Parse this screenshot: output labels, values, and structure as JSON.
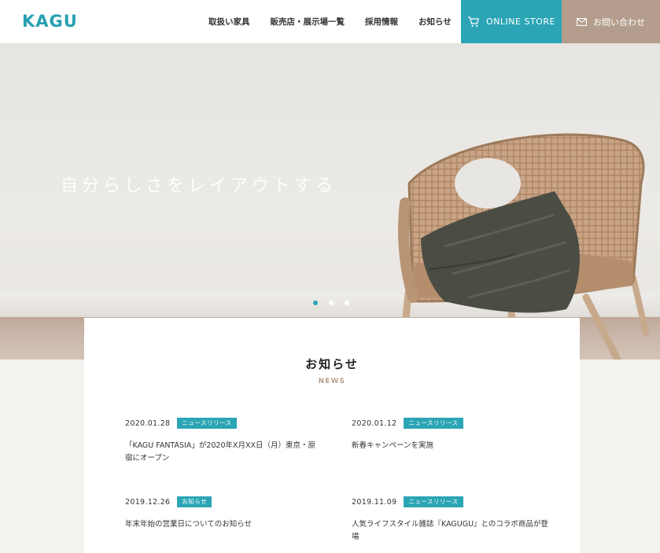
{
  "header": {
    "logo": "KAGU",
    "nav": [
      "取扱い家具",
      "販売店・展示場一覧",
      "採用情報",
      "お知らせ"
    ],
    "store_label": "ONLINE STORE",
    "contact_label": "お問い合わせ"
  },
  "hero": {
    "copy": "自分らしさをレイアウトする",
    "slides": 3,
    "active_slide": 1
  },
  "news": {
    "title": "お知らせ",
    "subtitle": "NEWS",
    "items": [
      {
        "date": "2020.01.28",
        "tag": "ニュースリリース",
        "title": "「KAGU FANTASIA」が2020年X月XX日（月）東京・原宿にオープン"
      },
      {
        "date": "2020.01.12",
        "tag": "ニュースリリース",
        "title": "新春キャンペーンを実施"
      },
      {
        "date": "2019.12.26",
        "tag": "お知らせ",
        "title": "年末年始の営業日についてのお知らせ"
      },
      {
        "date": "2019.11.09",
        "tag": "ニュースリリース",
        "title": "人気ライフスタイル雑誌『KAGUGU』とのコラボ商品が登場"
      }
    ]
  },
  "colors": {
    "accent": "#2ba5b5",
    "brand_brown": "#b49d8c",
    "logo": "#27a0b3"
  }
}
